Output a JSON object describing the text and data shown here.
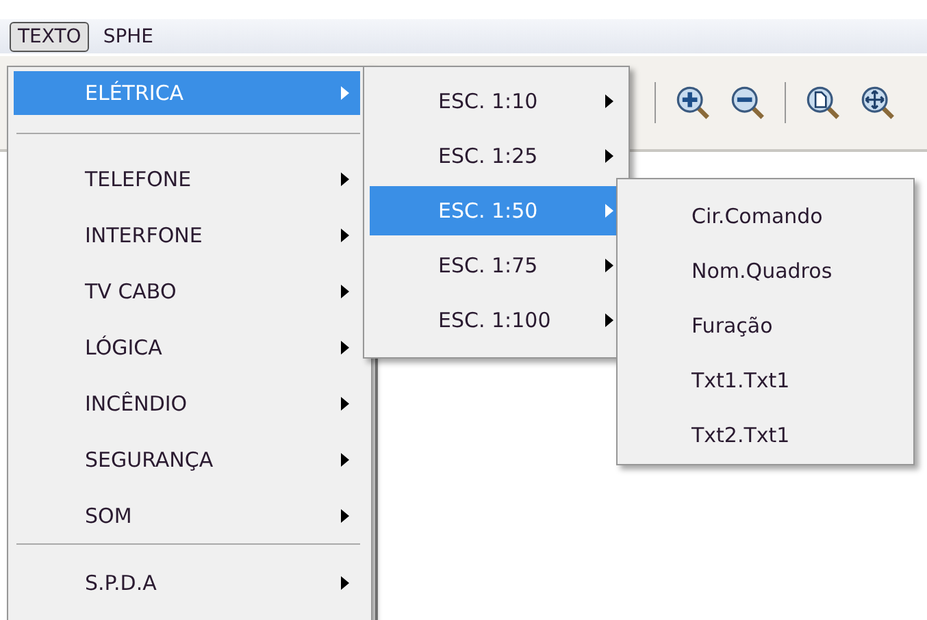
{
  "menu_bar": [
    {
      "label": "TEXTO",
      "selected": true
    },
    {
      "label": "SPHE",
      "selected": false
    }
  ],
  "menu": [
    {
      "kind": "item",
      "label": "ELÉTRICA",
      "selected": true,
      "submenu": true
    },
    {
      "kind": "separator"
    },
    {
      "kind": "item",
      "label": "TELEFONE",
      "selected": false,
      "submenu": true
    },
    {
      "kind": "item",
      "label": "INTERFONE",
      "selected": false,
      "submenu": true
    },
    {
      "kind": "item",
      "label": "TV CABO",
      "selected": false,
      "submenu": true
    },
    {
      "kind": "item",
      "label": "LÓGICA",
      "selected": false,
      "submenu": true
    },
    {
      "kind": "item",
      "label": "INCÊNDIO",
      "selected": false,
      "submenu": true
    },
    {
      "kind": "item",
      "label": "SEGURANÇA",
      "selected": false,
      "submenu": true
    },
    {
      "kind": "item",
      "label": "SOM",
      "selected": false,
      "submenu": true
    },
    {
      "kind": "separator"
    },
    {
      "kind": "item",
      "label": "S.P.D.A",
      "selected": false,
      "submenu": true
    }
  ],
  "submenu": [
    {
      "label": "ESC. 1:10",
      "selected": false,
      "submenu": true
    },
    {
      "label": "ESC. 1:25",
      "selected": false,
      "submenu": true
    },
    {
      "label": "ESC. 1:50",
      "selected": true,
      "submenu": true
    },
    {
      "label": "ESC. 1:75",
      "selected": false,
      "submenu": true
    },
    {
      "label": "ESC. 1:100",
      "selected": false,
      "submenu": true
    }
  ],
  "submenu_2": [
    {
      "label": "Cir.Comando",
      "selected": false
    },
    {
      "label": "Nom.Quadros",
      "selected": false
    },
    {
      "label": "Furação",
      "selected": false
    },
    {
      "label": "Txt1.Txt1",
      "selected": false
    },
    {
      "label": "Txt2.Txt1",
      "selected": false
    }
  ]
}
